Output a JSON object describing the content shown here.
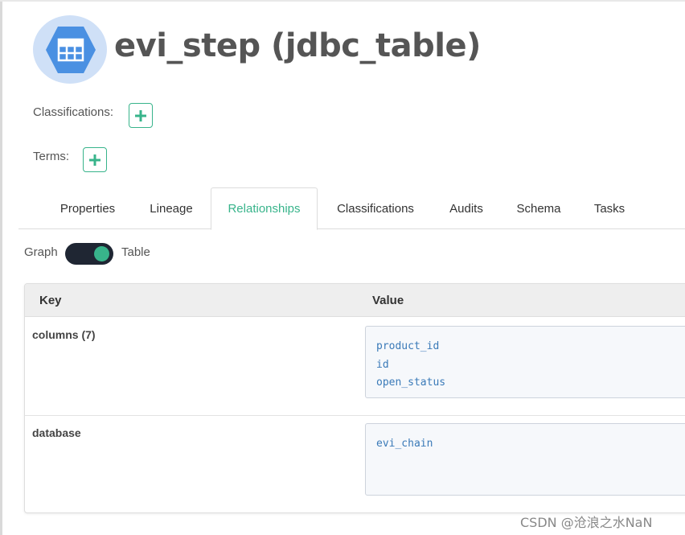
{
  "entity": {
    "title": "evi_step (jdbc_table)",
    "icon": "table-grid-icon"
  },
  "meta": {
    "classifications_label": "Classifications:",
    "terms_label": "Terms:"
  },
  "tabs": [
    {
      "label": "Properties",
      "active": false
    },
    {
      "label": "Lineage",
      "active": false
    },
    {
      "label": "Relationships",
      "active": true
    },
    {
      "label": "Classifications",
      "active": false
    },
    {
      "label": "Audits",
      "active": false
    },
    {
      "label": "Schema",
      "active": false
    },
    {
      "label": "Tasks",
      "active": false
    }
  ],
  "view_toggle": {
    "left_label": "Graph",
    "right_label": "Table",
    "state": "table"
  },
  "table": {
    "headers": {
      "key": "Key",
      "value": "Value"
    },
    "rows": [
      {
        "key": "columns (7)",
        "values": [
          "product_id",
          "id",
          "open_status"
        ]
      },
      {
        "key": "database",
        "values": [
          "evi_chain"
        ]
      }
    ]
  },
  "watermark": "CSDN @沧浪之水NaN",
  "colors": {
    "accent": "#38b48b",
    "icon_blue": "#4a90e2",
    "icon_bg": "#cfe0f7",
    "toggle_bg": "#1f2633",
    "link_text": "#3a7ab8"
  }
}
